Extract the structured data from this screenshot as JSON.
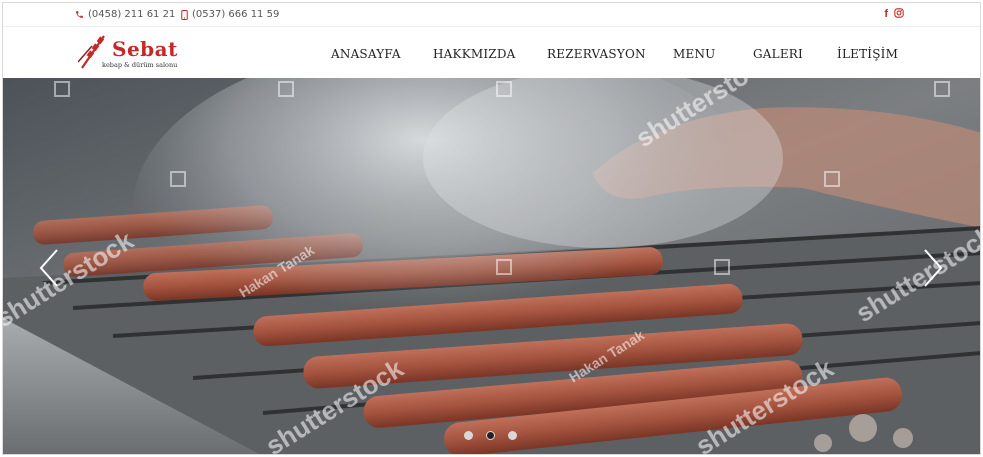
{
  "topbar": {
    "phone_1": "(0458) 211 61 21",
    "phone_2": "(0537) 666 11 59",
    "icons": [
      "phone-icon",
      "mobile-icon",
      "facebook-icon",
      "instagram-icon"
    ],
    "facebook_glyph": "f",
    "instagram_glyph": "◎"
  },
  "logo": {
    "brand": "Sebat",
    "tagline": "kebap & dürüm salonu"
  },
  "nav": {
    "items": [
      {
        "label": "ANASAYFA"
      },
      {
        "label": "HAKKMIZDA"
      },
      {
        "label": "REZERVASYON"
      },
      {
        "label": "MENU"
      },
      {
        "label": "GALERI"
      },
      {
        "label": "İLETİŞİM"
      }
    ]
  },
  "slider": {
    "slide_count": 3,
    "active_index": 1,
    "watermarks": [
      "shutterstock",
      "Hakan Tanak"
    ]
  },
  "colors": {
    "accent": "#c62828",
    "text": "#222222",
    "meat": "#a5543f"
  }
}
